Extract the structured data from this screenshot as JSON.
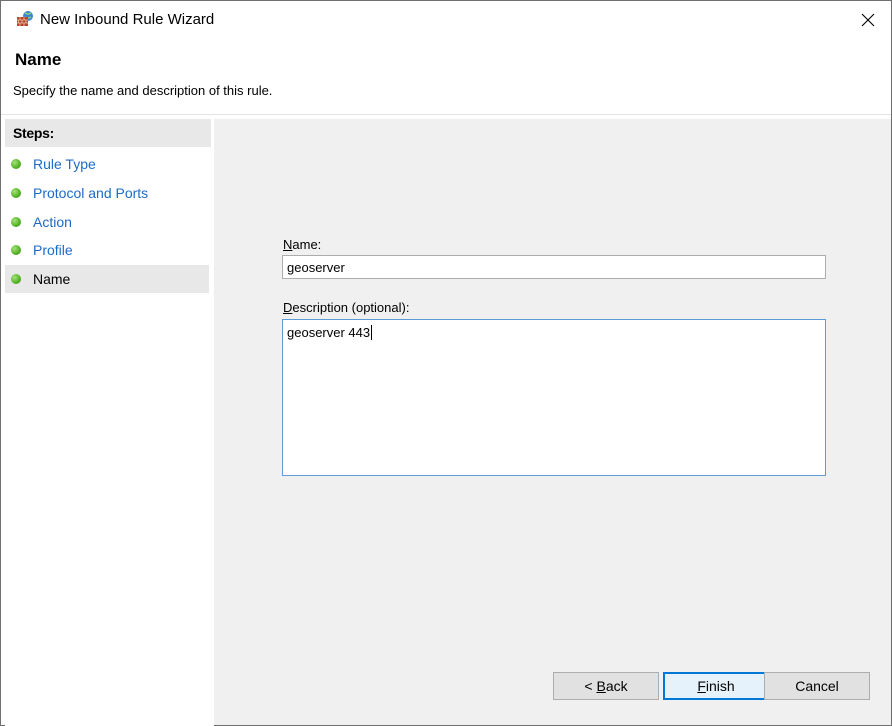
{
  "window": {
    "title": "New Inbound Rule Wizard",
    "icon": "firewall-icon"
  },
  "header": {
    "title": "Name",
    "description": "Specify the name and description of this rule."
  },
  "steps": {
    "title": "Steps:",
    "items": [
      {
        "label": "Rule Type",
        "current": false
      },
      {
        "label": "Protocol and Ports",
        "current": false
      },
      {
        "label": "Action",
        "current": false
      },
      {
        "label": "Profile",
        "current": false
      },
      {
        "label": "Name",
        "current": true
      }
    ]
  },
  "form": {
    "name_label_accel": "N",
    "name_label_rest": "ame:",
    "name_value": "geoserver",
    "desc_label_accel": "D",
    "desc_label_rest": "escription (optional):",
    "desc_value": "geoserver 443"
  },
  "buttons": {
    "back_prefix": "< ",
    "back_accel": "B",
    "back_rest": "ack",
    "finish_accel": "F",
    "finish_rest": "inish",
    "cancel": "Cancel"
  },
  "colors": {
    "link": "#1c6bc7",
    "focus_border": "#0078d7",
    "content_bg": "#f0f0f0"
  }
}
